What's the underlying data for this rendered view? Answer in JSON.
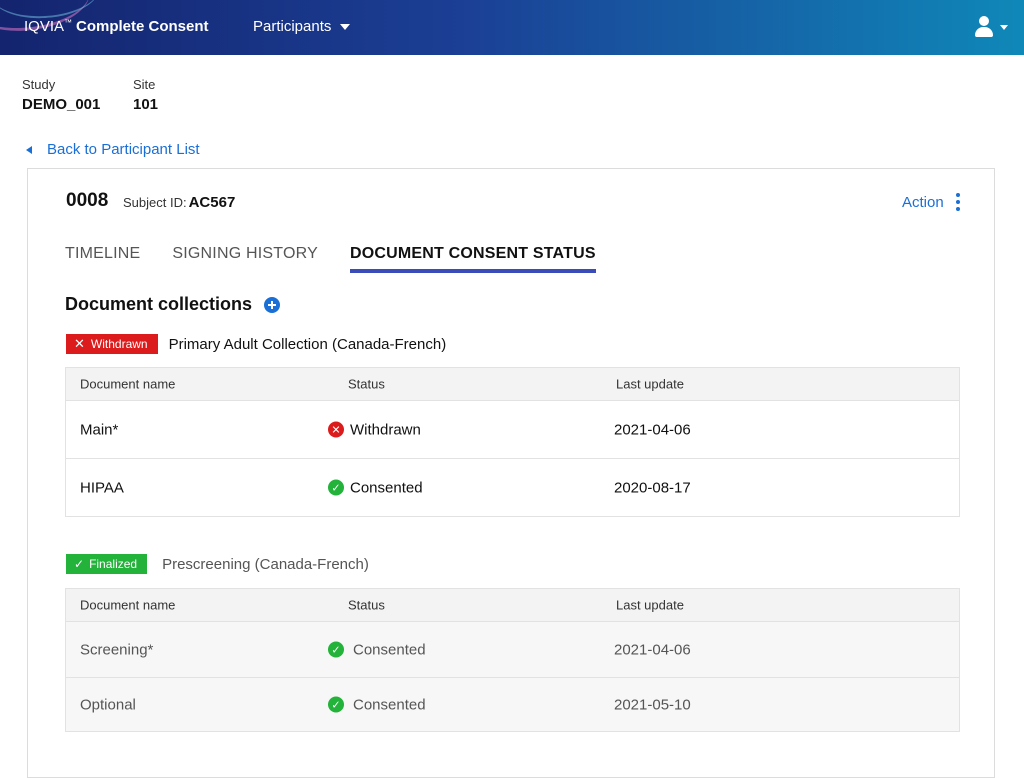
{
  "header": {
    "brand_name": "IQVIA",
    "brand_tm": "™",
    "product_name": "Complete Consent",
    "nav_participants": "Participants",
    "user_icon": "user-icon"
  },
  "study": {
    "label": "Study",
    "value": "DEMO_001"
  },
  "site": {
    "label": "Site",
    "value": "101"
  },
  "back_link": "Back to Participant List",
  "participant": {
    "id": "0008",
    "subject_label": "Subject ID:",
    "subject_id": "AC567",
    "action_label": "Action"
  },
  "tabs": [
    {
      "label": "TIMELINE",
      "active": false
    },
    {
      "label": "SIGNING HISTORY",
      "active": false
    },
    {
      "label": "DOCUMENT CONSENT STATUS",
      "active": true
    }
  ],
  "section_title": "Document collections",
  "table_headers": {
    "name": "Document name",
    "status": "Status",
    "updated": "Last update"
  },
  "collections": [
    {
      "badge": "Withdrawn",
      "badge_color": "#dc1c1c",
      "name": "Primary Adult Collection (Canada-French)",
      "documents": [
        {
          "name": "Main*",
          "status": "Withdrawn",
          "status_icon": "x-circle-icon",
          "last_update": "2021-04-06"
        },
        {
          "name": "HIPAA",
          "status": "Consented",
          "status_icon": "check-circle-icon",
          "last_update": "2020-08-17"
        }
      ]
    },
    {
      "badge": "Finalized",
      "badge_color": "#23b23a",
      "name": "Prescreening (Canada-French)",
      "documents": [
        {
          "name": "Screening*",
          "status": "Consented",
          "status_icon": "check-circle-icon",
          "last_update": "2021-04-06"
        },
        {
          "name": "Optional",
          "status": "Consented",
          "status_icon": "check-circle-icon",
          "last_update": "2021-05-10"
        }
      ]
    }
  ],
  "colors": {
    "accent": "#1a6fd6",
    "tab_underline": "#3b4cb8",
    "withdrawn": "#dc1c1c",
    "consented": "#23b23a"
  }
}
